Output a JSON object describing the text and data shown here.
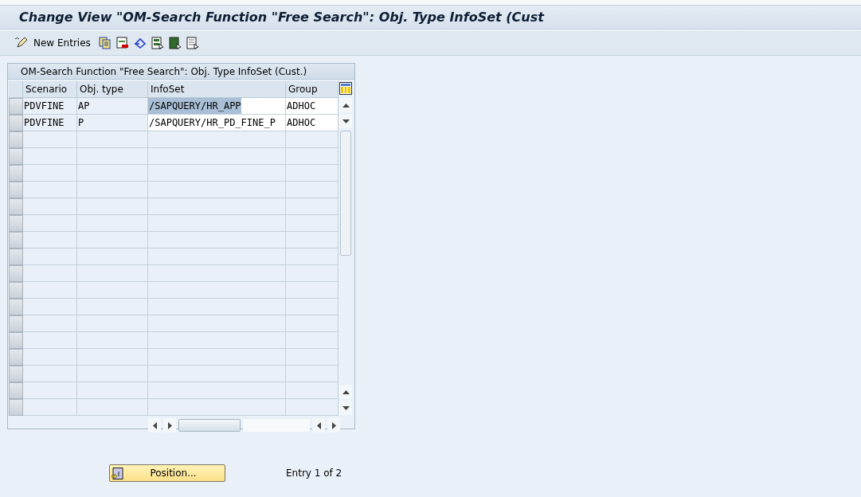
{
  "window": {
    "title": "Change View \"OM-Search Function \"Free Search\": Obj. Type InfoSet (Cust"
  },
  "toolbar": {
    "new_entries": "New Entries"
  },
  "table": {
    "title": "OM-Search Function \"Free Search\": Obj. Type InfoSet (Cust.)",
    "columns": [
      "Scenario",
      "Obj. type",
      "InfoSet",
      "Group"
    ],
    "rows": [
      {
        "cells": [
          "PDVFINE",
          "AP",
          "/SAPQUERY/HR_APP",
          "ADHOC"
        ],
        "infoset_highlighted": true
      },
      {
        "cells": [
          "PDVFINE",
          "P",
          "/SAPQUERY/HR_PD_FINE_P",
          "ADHOC"
        ],
        "infoset_highlighted": false
      }
    ]
  },
  "footer": {
    "position_button": "Position...",
    "entry_info": "Entry 1 of 2"
  }
}
